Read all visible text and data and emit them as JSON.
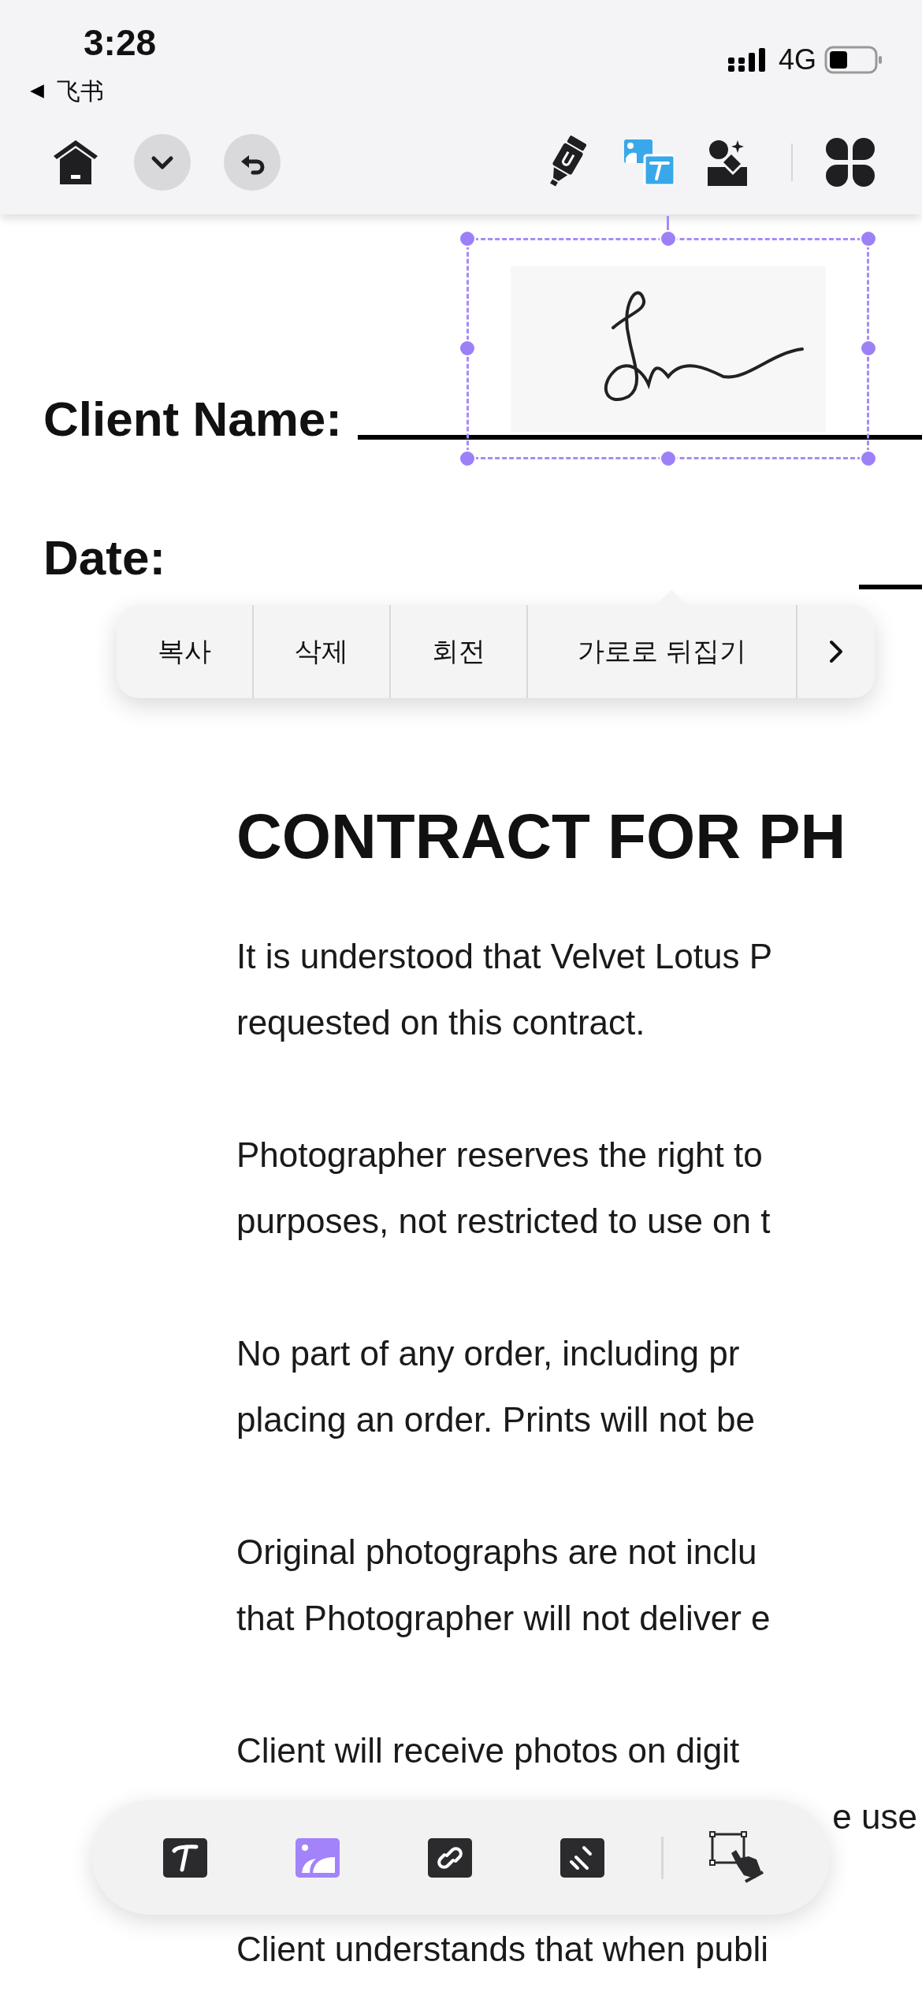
{
  "status_bar": {
    "time": "3:28",
    "back_app": "飞书",
    "network": "4G"
  },
  "document": {
    "fields": [
      {
        "label": "Client Name:"
      },
      {
        "label": "Date:"
      }
    ],
    "heading": "CONTRACT FOR PH",
    "paragraphs": [
      {
        "lines": [
          {
            "text": "It is understood that Velvet Lotus P",
            "kind": "full"
          },
          {
            "text": "requested on this contract.",
            "kind": "full"
          }
        ]
      },
      {
        "lines": [
          {
            "text": "Photographer reserves the right to",
            "kind": "full"
          },
          {
            "text": "purposes, not restricted to use on t",
            "kind": "full"
          }
        ]
      },
      {
        "lines": [
          {
            "text": "No part of any order, including pr",
            "kind": "full"
          },
          {
            "text": "placing an order. Prints will not be",
            "kind": "full"
          }
        ]
      },
      {
        "lines": [
          {
            "text": "Original photographs are not inclu",
            "kind": "full"
          },
          {
            "text": "that Photographer will not deliver e",
            "kind": "full"
          }
        ]
      },
      {
        "lines": [
          {
            "text": "Client will receive photos on digit",
            "kind": "full"
          },
          {
            "text": "e use",
            "kind": "covered"
          }
        ]
      },
      {
        "lines": [
          {
            "text": "Client understands that when publi",
            "kind": "full"
          }
        ]
      }
    ]
  },
  "context_menu": {
    "items": [
      "복사",
      "삭제",
      "회전",
      "가로로 뒤집기"
    ]
  },
  "bottom_toolbar": {
    "tools": [
      {
        "kind": "text",
        "selected": false
      },
      {
        "kind": "image",
        "selected": true
      },
      {
        "kind": "link",
        "selected": false
      },
      {
        "kind": "strike",
        "selected": false
      },
      {
        "kind": "select",
        "selected": false
      }
    ]
  }
}
